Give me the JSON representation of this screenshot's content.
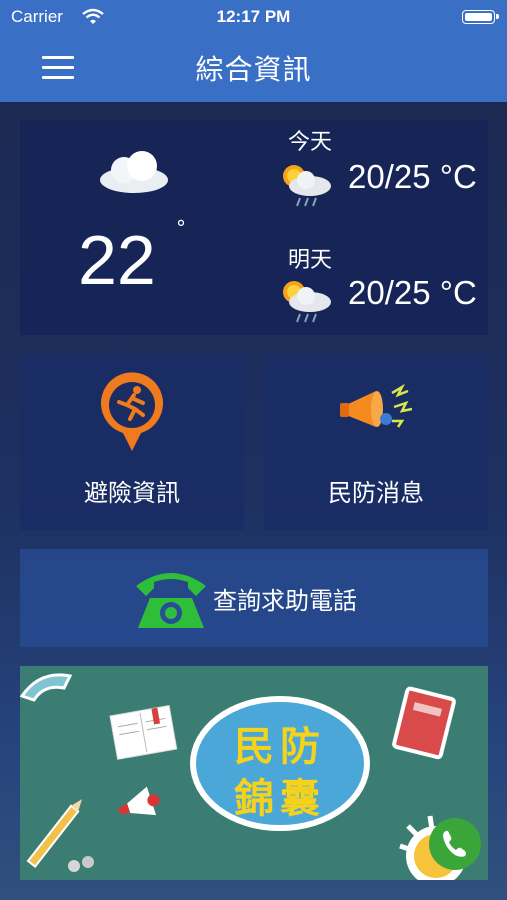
{
  "status_bar": {
    "carrier": "Carrier",
    "time": "12:17 PM"
  },
  "nav": {
    "title": "綜合資訊",
    "menu_icon": "hamburger-menu-icon"
  },
  "weather": {
    "current_temp": "22",
    "degree_symbol": "°",
    "current_icon": "cloud-icon",
    "today": {
      "label": "今天",
      "range": "20/25 °C",
      "icon": "sun-cloud-rain-icon"
    },
    "tomorrow": {
      "label": "明天",
      "range": "20/25 °C",
      "icon": "sun-cloud-rain-icon"
    }
  },
  "tiles": {
    "escape": {
      "label": "避險資訊",
      "icon": "running-person-pin-icon",
      "color": "#f07a1e"
    },
    "news": {
      "label": "民防消息",
      "icon": "megaphone-icon"
    }
  },
  "helpline": {
    "label": "查詢求助電話",
    "icon": "telephone-icon",
    "color": "#2fbe3a"
  },
  "banner": {
    "line1": "民防",
    "line2": "錦囊",
    "accent_color": "#f5d21c",
    "bg_color": "#3b7d72",
    "fab_icon": "phone-call-icon"
  }
}
